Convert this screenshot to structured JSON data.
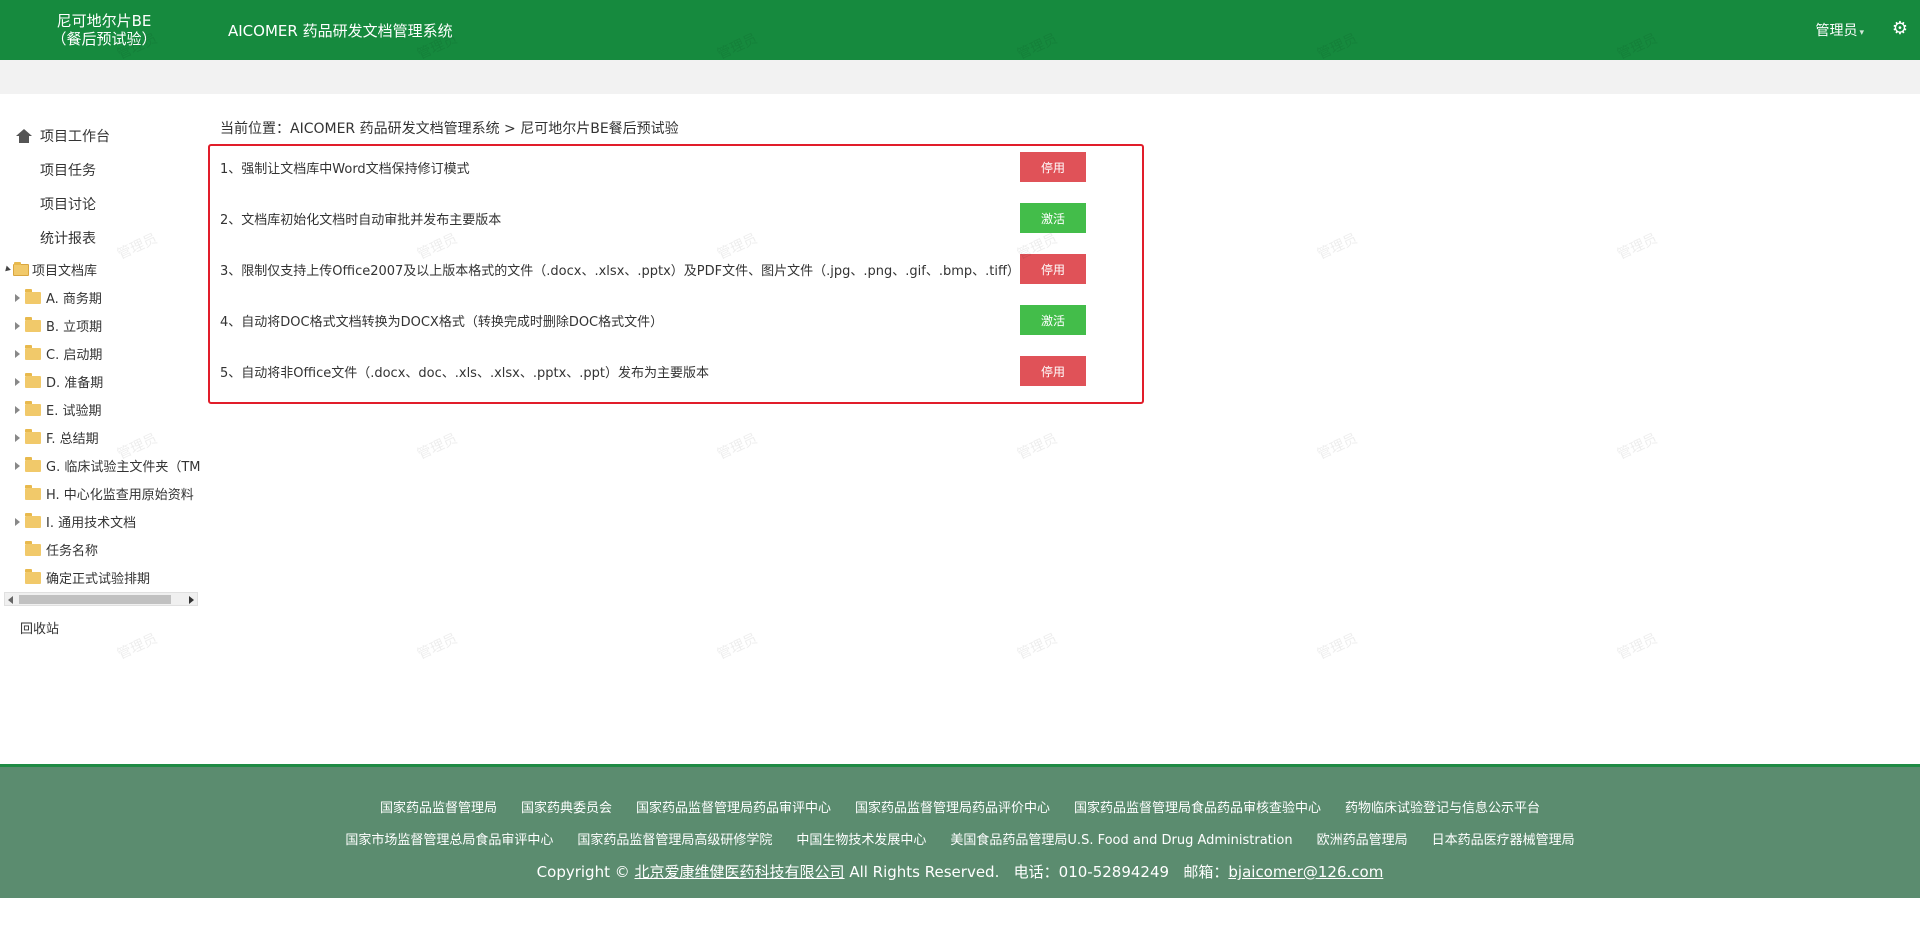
{
  "header": {
    "logo_line1": "尼可地尔片BE",
    "logo_line2": "（餐后预试验）",
    "app_title": "AICOMER 药品研发文档管理系统",
    "user": "管理员",
    "user_caret": "▾",
    "gear": "⚙"
  },
  "sidebar": {
    "workbench": "项目工作台",
    "items": [
      "项目任务",
      "项目讨论",
      "统计报表"
    ],
    "tree_root": "项目文档库",
    "tree": [
      {
        "label": "A. 商务期",
        "expandable": true
      },
      {
        "label": "B. 立项期",
        "expandable": true
      },
      {
        "label": "C. 启动期",
        "expandable": true
      },
      {
        "label": "D. 准备期",
        "expandable": true
      },
      {
        "label": "E. 试验期",
        "expandable": true
      },
      {
        "label": "F. 总结期",
        "expandable": true
      },
      {
        "label": "G. 临床试验主文件夹（TM",
        "expandable": true
      },
      {
        "label": "H. 中心化监查用原始资料",
        "expandable": false
      },
      {
        "label": "I. 通用技术文档",
        "expandable": true
      },
      {
        "label": "任务名称",
        "expandable": false
      },
      {
        "label": "确定正式试验排期",
        "expandable": false
      }
    ],
    "recycle": "回收站"
  },
  "breadcrumb": "当前位置：AICOMER 药品研发文档管理系统 > 尼可地尔片BE餐后预试验",
  "settings": [
    {
      "text": "1、强制让文档库中Word文档保持修订模式",
      "button": "停用",
      "state": "disable"
    },
    {
      "text": "2、文档库初始化文档时自动审批并发布主要版本",
      "button": "激活",
      "state": "activate"
    },
    {
      "text": "3、限制仅支持上传Office2007及以上版本格式的文件（.docx、.xlsx、.pptx）及PDF文件、图片文件（.jpg、.png、.gif、.bmp、.tiff）",
      "button": "停用",
      "state": "disable"
    },
    {
      "text": "4、自动将DOC格式文档转换为DOCX格式（转换完成时删除DOC格式文件）",
      "button": "激活",
      "state": "activate"
    },
    {
      "text": "5、自动将非Office文件（.docx、doc、.xls、.xlsx、.pptx、.ppt）发布为主要版本",
      "button": "停用",
      "state": "disable"
    }
  ],
  "watermark": "管理员",
  "footer": {
    "row1": [
      "国家药品监督管理局",
      "国家药典委员会",
      "国家药品监督管理局药品审评中心",
      "国家药品监督管理局药品评价中心",
      "国家药品监督管理局食品药品审核查验中心",
      "药物临床试验登记与信息公示平台"
    ],
    "row2": [
      "国家市场监督管理总局食品审评中心",
      "国家药品监督管理局高级研修学院",
      "中国生物技术发展中心",
      "美国食品药品管理局U.S. Food and Drug Administration",
      "欧洲药品管理局",
      "日本药品医疗器械管理局"
    ],
    "copyright_prefix": "Copyright ©",
    "company": "北京爱康维健医药科技有限公司",
    "rights": "All Rights Reserved.",
    "phone": "电话：010-52894249",
    "email_label": "邮箱：",
    "email": "bjaicomer@126.com"
  },
  "colors": {
    "header_bg": "#168a3e",
    "disable_btn": "#e05258",
    "activate_btn": "#43bd4a",
    "footer_bg": "#5b8c6f",
    "highlight_border": "#e11d2a"
  }
}
